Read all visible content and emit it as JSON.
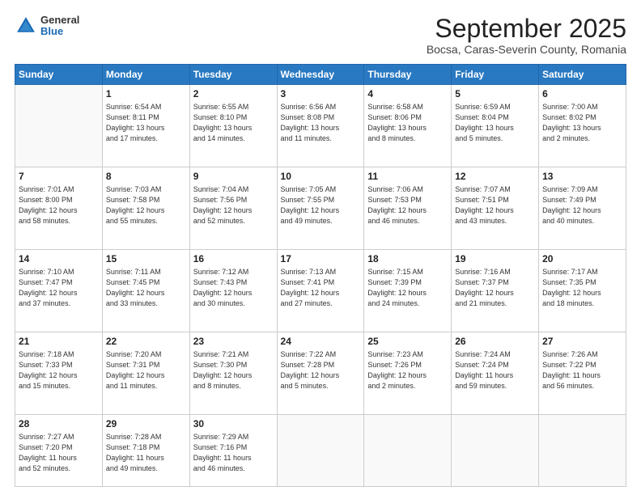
{
  "header": {
    "logo": {
      "general": "General",
      "blue": "Blue"
    },
    "title": "September 2025",
    "subtitle": "Bocsa, Caras-Severin County, Romania"
  },
  "weekdays": [
    "Sunday",
    "Monday",
    "Tuesday",
    "Wednesday",
    "Thursday",
    "Friday",
    "Saturday"
  ],
  "weeks": [
    [
      {
        "day": "",
        "content": ""
      },
      {
        "day": "1",
        "content": "Sunrise: 6:54 AM\nSunset: 8:11 PM\nDaylight: 13 hours\nand 17 minutes."
      },
      {
        "day": "2",
        "content": "Sunrise: 6:55 AM\nSunset: 8:10 PM\nDaylight: 13 hours\nand 14 minutes."
      },
      {
        "day": "3",
        "content": "Sunrise: 6:56 AM\nSunset: 8:08 PM\nDaylight: 13 hours\nand 11 minutes."
      },
      {
        "day": "4",
        "content": "Sunrise: 6:58 AM\nSunset: 8:06 PM\nDaylight: 13 hours\nand 8 minutes."
      },
      {
        "day": "5",
        "content": "Sunrise: 6:59 AM\nSunset: 8:04 PM\nDaylight: 13 hours\nand 5 minutes."
      },
      {
        "day": "6",
        "content": "Sunrise: 7:00 AM\nSunset: 8:02 PM\nDaylight: 13 hours\nand 2 minutes."
      }
    ],
    [
      {
        "day": "7",
        "content": "Sunrise: 7:01 AM\nSunset: 8:00 PM\nDaylight: 12 hours\nand 58 minutes."
      },
      {
        "day": "8",
        "content": "Sunrise: 7:03 AM\nSunset: 7:58 PM\nDaylight: 12 hours\nand 55 minutes."
      },
      {
        "day": "9",
        "content": "Sunrise: 7:04 AM\nSunset: 7:56 PM\nDaylight: 12 hours\nand 52 minutes."
      },
      {
        "day": "10",
        "content": "Sunrise: 7:05 AM\nSunset: 7:55 PM\nDaylight: 12 hours\nand 49 minutes."
      },
      {
        "day": "11",
        "content": "Sunrise: 7:06 AM\nSunset: 7:53 PM\nDaylight: 12 hours\nand 46 minutes."
      },
      {
        "day": "12",
        "content": "Sunrise: 7:07 AM\nSunset: 7:51 PM\nDaylight: 12 hours\nand 43 minutes."
      },
      {
        "day": "13",
        "content": "Sunrise: 7:09 AM\nSunset: 7:49 PM\nDaylight: 12 hours\nand 40 minutes."
      }
    ],
    [
      {
        "day": "14",
        "content": "Sunrise: 7:10 AM\nSunset: 7:47 PM\nDaylight: 12 hours\nand 37 minutes."
      },
      {
        "day": "15",
        "content": "Sunrise: 7:11 AM\nSunset: 7:45 PM\nDaylight: 12 hours\nand 33 minutes."
      },
      {
        "day": "16",
        "content": "Sunrise: 7:12 AM\nSunset: 7:43 PM\nDaylight: 12 hours\nand 30 minutes."
      },
      {
        "day": "17",
        "content": "Sunrise: 7:13 AM\nSunset: 7:41 PM\nDaylight: 12 hours\nand 27 minutes."
      },
      {
        "day": "18",
        "content": "Sunrise: 7:15 AM\nSunset: 7:39 PM\nDaylight: 12 hours\nand 24 minutes."
      },
      {
        "day": "19",
        "content": "Sunrise: 7:16 AM\nSunset: 7:37 PM\nDaylight: 12 hours\nand 21 minutes."
      },
      {
        "day": "20",
        "content": "Sunrise: 7:17 AM\nSunset: 7:35 PM\nDaylight: 12 hours\nand 18 minutes."
      }
    ],
    [
      {
        "day": "21",
        "content": "Sunrise: 7:18 AM\nSunset: 7:33 PM\nDaylight: 12 hours\nand 15 minutes."
      },
      {
        "day": "22",
        "content": "Sunrise: 7:20 AM\nSunset: 7:31 PM\nDaylight: 12 hours\nand 11 minutes."
      },
      {
        "day": "23",
        "content": "Sunrise: 7:21 AM\nSunset: 7:30 PM\nDaylight: 12 hours\nand 8 minutes."
      },
      {
        "day": "24",
        "content": "Sunrise: 7:22 AM\nSunset: 7:28 PM\nDaylight: 12 hours\nand 5 minutes."
      },
      {
        "day": "25",
        "content": "Sunrise: 7:23 AM\nSunset: 7:26 PM\nDaylight: 12 hours\nand 2 minutes."
      },
      {
        "day": "26",
        "content": "Sunrise: 7:24 AM\nSunset: 7:24 PM\nDaylight: 11 hours\nand 59 minutes."
      },
      {
        "day": "27",
        "content": "Sunrise: 7:26 AM\nSunset: 7:22 PM\nDaylight: 11 hours\nand 56 minutes."
      }
    ],
    [
      {
        "day": "28",
        "content": "Sunrise: 7:27 AM\nSunset: 7:20 PM\nDaylight: 11 hours\nand 52 minutes."
      },
      {
        "day": "29",
        "content": "Sunrise: 7:28 AM\nSunset: 7:18 PM\nDaylight: 11 hours\nand 49 minutes."
      },
      {
        "day": "30",
        "content": "Sunrise: 7:29 AM\nSunset: 7:16 PM\nDaylight: 11 hours\nand 46 minutes."
      },
      {
        "day": "",
        "content": ""
      },
      {
        "day": "",
        "content": ""
      },
      {
        "day": "",
        "content": ""
      },
      {
        "day": "",
        "content": ""
      }
    ]
  ]
}
